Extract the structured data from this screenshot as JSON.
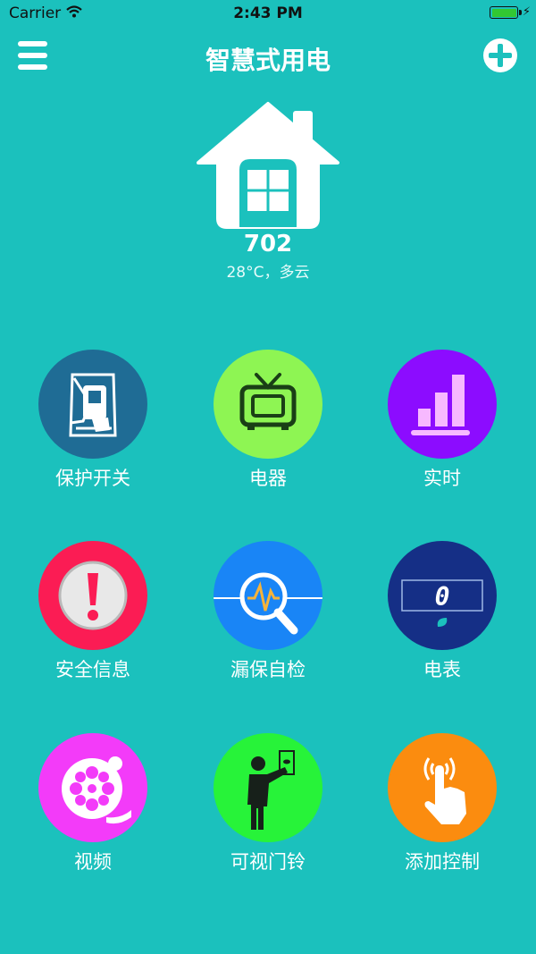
{
  "status_bar": {
    "carrier": "Carrier",
    "time": "2:43 PM"
  },
  "nav": {
    "title": "智慧式用电"
  },
  "home": {
    "room": "702",
    "weather": "28°C，多云"
  },
  "colors": {
    "background": "#1bc1bd"
  },
  "grid": [
    {
      "label": "保护开关",
      "icon": "circuit-breaker-icon",
      "color": "#1f6c95"
    },
    {
      "label": "电器",
      "icon": "tv-icon",
      "color": "#8ef553"
    },
    {
      "label": "实时",
      "icon": "bar-chart-icon",
      "color": "#8c0cff"
    },
    {
      "label": "安全信息",
      "icon": "alert-icon",
      "color": "#fb1c54"
    },
    {
      "label": "漏保自检",
      "icon": "magnifier-icon",
      "color": "#1985f6"
    },
    {
      "label": "电表",
      "icon": "meter-icon",
      "color": "#152f86"
    },
    {
      "label": "视频",
      "icon": "film-reel-icon",
      "color": "#f33bf9"
    },
    {
      "label": "可视门铃",
      "icon": "doorbell-icon",
      "color": "#27f339"
    },
    {
      "label": "添加控制",
      "icon": "touch-icon",
      "color": "#fb8c0f"
    }
  ],
  "meter": {
    "reading": "0"
  }
}
